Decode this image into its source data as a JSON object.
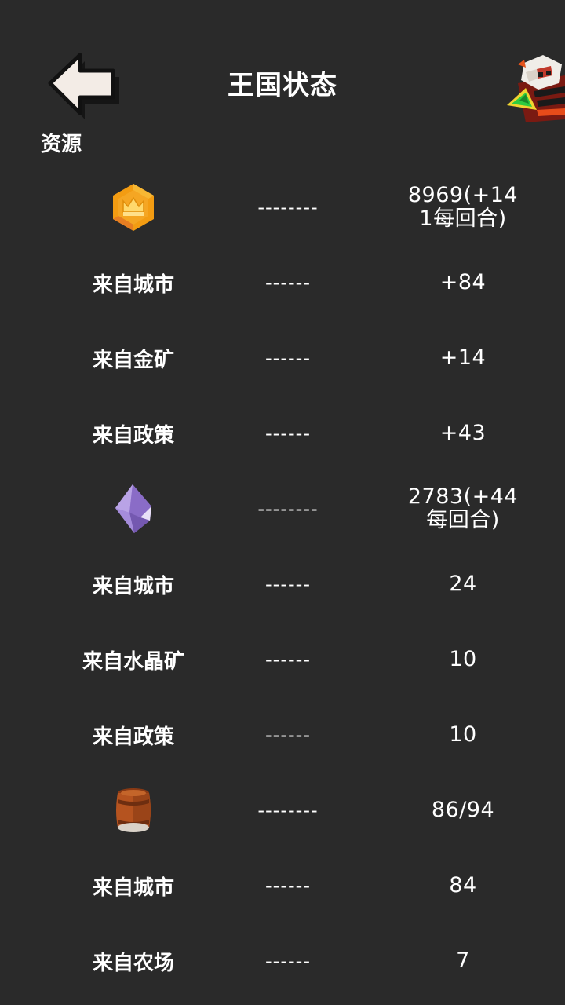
{
  "header": {
    "title": "王国状态",
    "back_icon": "back-arrow-icon",
    "avatar_icon": "ruler-avatar-icon"
  },
  "section_label": "资源",
  "gold": {
    "icon": "gold-crown-coin-icon",
    "dashes": "--------",
    "total": "8969(+141每回合)",
    "sources": [
      {
        "label": "来自城市",
        "dashes": "------",
        "value": "+84"
      },
      {
        "label": "来自金矿",
        "dashes": "------",
        "value": "+14"
      },
      {
        "label": "来自政策",
        "dashes": "------",
        "value": "+43"
      }
    ]
  },
  "crystal": {
    "icon": "purple-crystal-icon",
    "dashes": "--------",
    "total": "2783(+44每回合)",
    "sources": [
      {
        "label": "来自城市",
        "dashes": "------",
        "value": "24"
      },
      {
        "label": "来自水晶矿",
        "dashes": "------",
        "value": "10"
      },
      {
        "label": "来自政策",
        "dashes": "------",
        "value": "10"
      }
    ]
  },
  "food": {
    "icon": "food-barrel-icon",
    "dashes": "--------",
    "total": "86/94",
    "sources": [
      {
        "label": "来自城市",
        "dashes": "------",
        "value": "84"
      },
      {
        "label": "来自农场",
        "dashes": "------",
        "value": "7"
      }
    ]
  },
  "colors": {
    "background": "#2a2a2a",
    "text": "#ffffff",
    "gold": "#f5a623",
    "crystal": "#9b7fd4",
    "barrel": "#b5531f"
  }
}
